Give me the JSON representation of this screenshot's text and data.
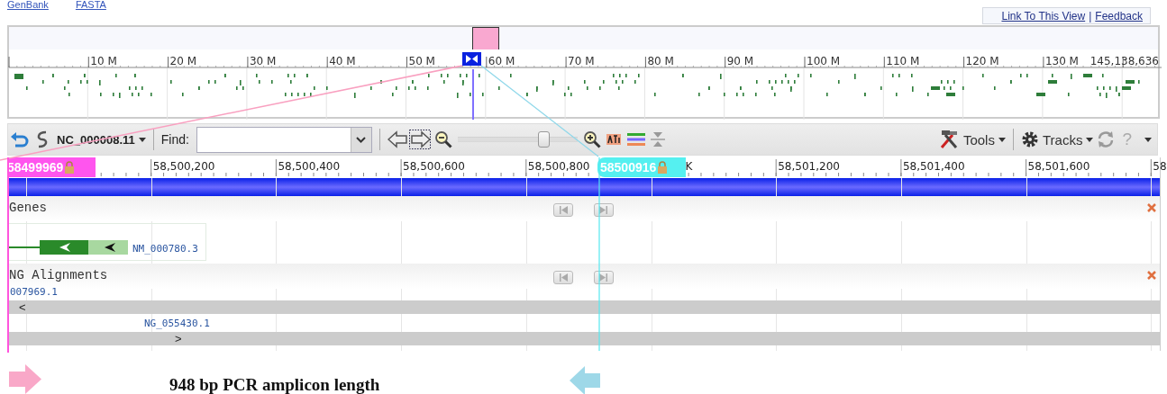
{
  "header_links": [
    "GenBank",
    "FASTA"
  ],
  "view_links": {
    "items": [
      "Link To This View",
      "Feedback"
    ],
    "separator": "|"
  },
  "overview": {
    "ruler_labels": [
      "10 M",
      "20 M",
      "30 M",
      "40 M",
      "50 M",
      "60 M",
      "70 M",
      "80 M",
      "90 M",
      "100 M",
      "110 M",
      "120 M",
      "130 M"
    ],
    "end_label": "145,138,636"
  },
  "toolbar": {
    "sequence": "NC_000008.11",
    "find_label": "Find:",
    "zoom": {
      "level": 0.72
    },
    "tools": "Tools",
    "tracks": "Tracks",
    "help": "?"
  },
  "ruler": {
    "start_marker": "58499969",
    "end_marker": "58500916",
    "labels": [
      "58,500,200",
      "58,500,400",
      "58,500,600",
      "58,500,800",
      "K",
      "58,501,200",
      "58,501,400",
      "58,501,600",
      "58"
    ]
  },
  "tracks": [
    {
      "kind": "genes",
      "title": "Genes",
      "features": [
        {
          "label": "NM_000780.3"
        }
      ]
    },
    {
      "kind": "alignments",
      "title": "NG Alignments",
      "features": [
        {
          "label": "007969.1",
          "direction": "<"
        },
        {
          "label": "NG_055430.1",
          "direction": ">"
        }
      ]
    }
  ],
  "amplicon": {
    "label": "948 bp PCR amplicon length"
  }
}
